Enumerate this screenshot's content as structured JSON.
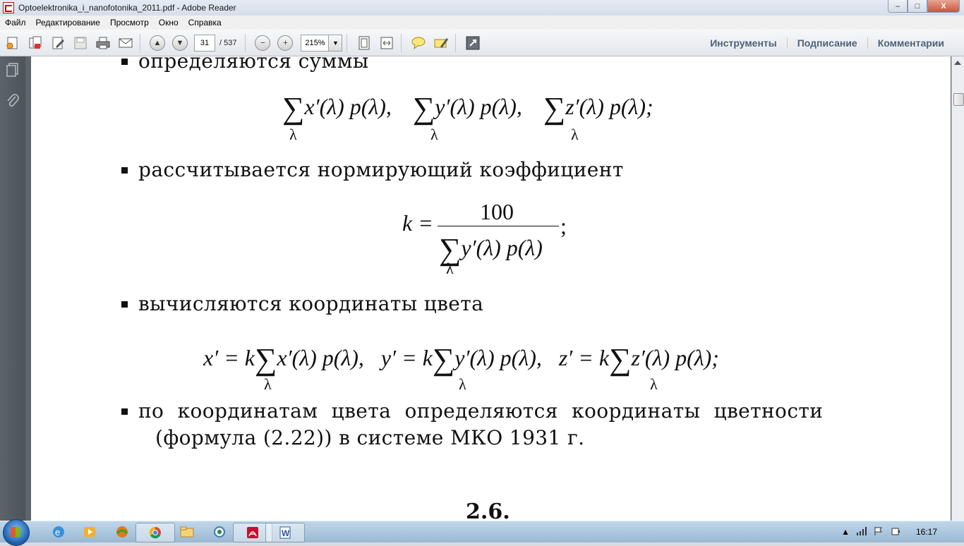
{
  "window": {
    "title": "Optoelektronika_i_nanofotonika_2011.pdf - Adobe Reader",
    "min": "–",
    "max": "□",
    "close": "X"
  },
  "menu": [
    "Файл",
    "Редактирование",
    "Просмотр",
    "Окно",
    "Справка"
  ],
  "toolbar": {
    "page_current": "31",
    "page_total": "/ 537",
    "zoom": "215%",
    "right_tabs": [
      "Инструменты",
      "Подписание",
      "Комментарии"
    ]
  },
  "document": {
    "bullet1": "определяются суммы",
    "formula1_terms": [
      "x′(λ) p(λ),",
      "y′(λ) p(λ),",
      "z′(λ) p(λ);"
    ],
    "sum_index": "λ",
    "bullet2": "рассчитывается нормирующий коэффициент",
    "formula2_lhs": "k =",
    "formula2_num": "100",
    "formula2_den": "y′(λ) p(λ)",
    "formula2_end": ";",
    "bullet3": "вычисляются координаты цвета",
    "formula3_terms": [
      "x′ = k",
      "x′(λ) p(λ),",
      "y′ = k",
      "y′(λ) p(λ),",
      "z′ = k",
      "z′(λ) p(λ);"
    ],
    "bullet4_line1": "по координатам цвета определяются координаты цветности",
    "bullet4_line2": "(формула (2.22)) в системе МКО 1931 г.",
    "section": "2.6."
  },
  "taskbar": {
    "time": "16:17"
  }
}
